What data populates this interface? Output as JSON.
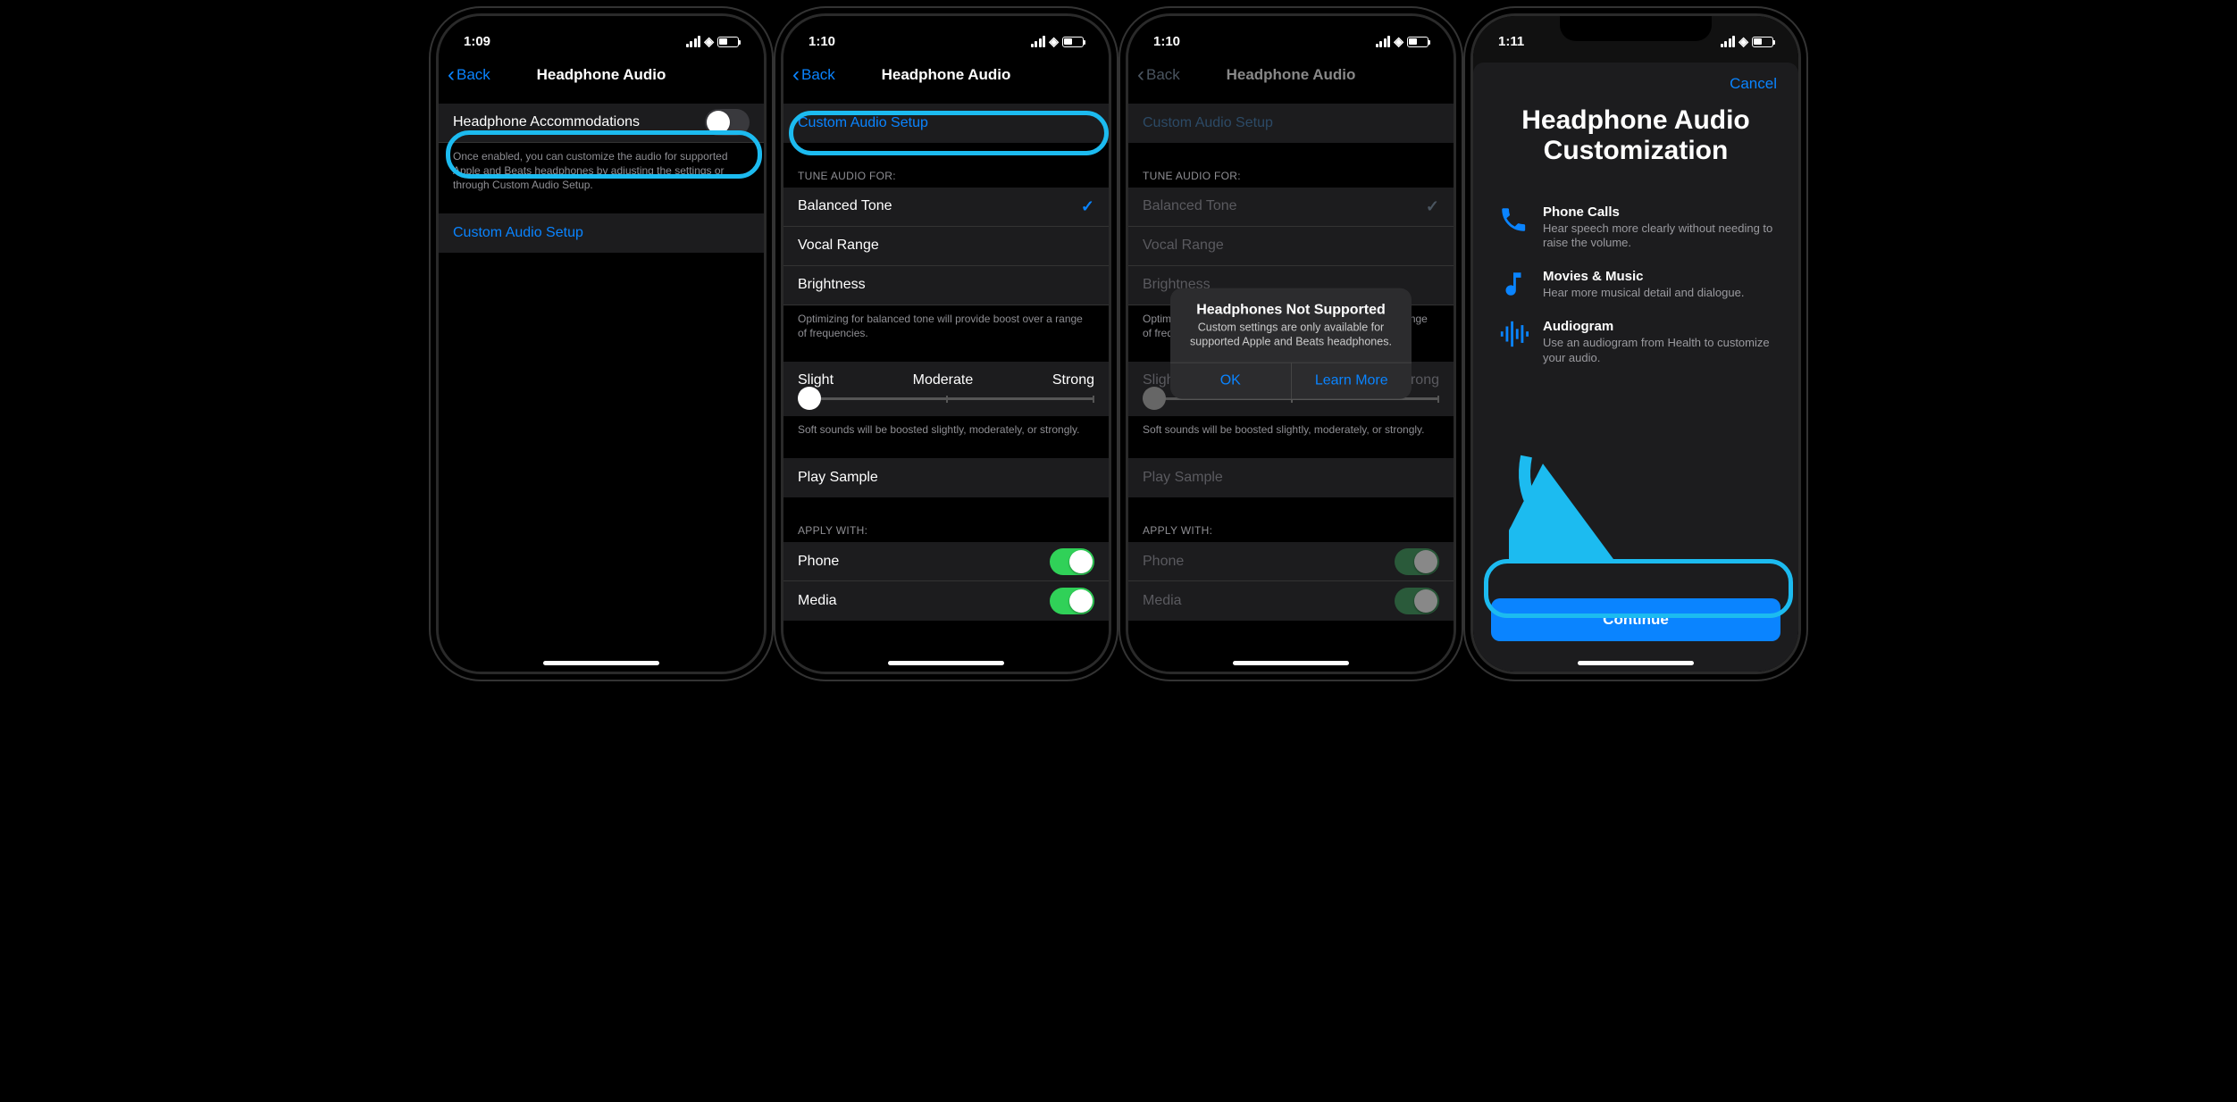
{
  "screens": {
    "s1": {
      "time": "1:09",
      "back": "Back",
      "title": "Headphone Audio",
      "accommodations_label": "Headphone Accommodations",
      "accommodations_footer": "Once enabled, you can customize the audio for supported Apple and Beats headphones by adjusting the settings or through Custom Audio Setup.",
      "custom_setup": "Custom Audio Setup"
    },
    "s2": {
      "time": "1:10",
      "back": "Back",
      "title": "Headphone Audio",
      "custom_setup": "Custom Audio Setup",
      "tune_header": "TUNE AUDIO FOR:",
      "opt_balanced": "Balanced Tone",
      "opt_vocal": "Vocal Range",
      "opt_brightness": "Brightness",
      "tune_footer": "Optimizing for balanced tone will provide boost over a range of frequencies.",
      "slider_slight": "Slight",
      "slider_moderate": "Moderate",
      "slider_strong": "Strong",
      "slider_footer": "Soft sounds will be boosted slightly, moderately, or strongly.",
      "play_sample": "Play Sample",
      "apply_header": "APPLY WITH:",
      "apply_phone": "Phone",
      "apply_media": "Media"
    },
    "s3": {
      "time": "1:10",
      "back": "Back",
      "title": "Headphone Audio",
      "alert_title": "Headphones Not Supported",
      "alert_msg": "Custom settings are only available for supported Apple and Beats headphones.",
      "alert_ok": "OK",
      "alert_more": "Learn More"
    },
    "s4": {
      "time": "1:11",
      "cancel": "Cancel",
      "sheet_title": "Headphone Audio Customization",
      "f1_title": "Phone Calls",
      "f1_desc": "Hear speech more clearly without needing to raise the volume.",
      "f2_title": "Movies & Music",
      "f2_desc": "Hear more musical detail and dialogue.",
      "f3_title": "Audiogram",
      "f3_desc": "Use an audiogram from Health to customize your audio.",
      "continue": "Continue"
    }
  }
}
